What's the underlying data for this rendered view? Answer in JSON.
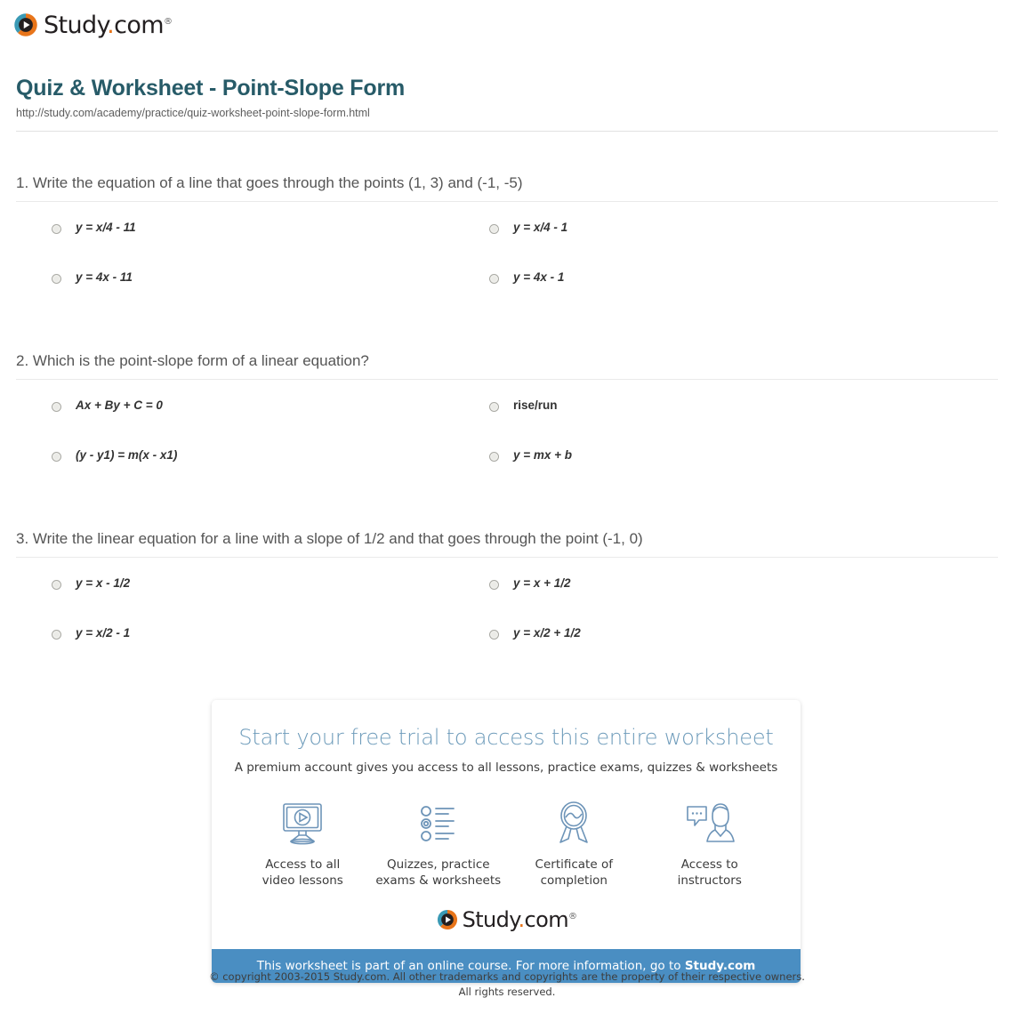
{
  "brand": {
    "name_main": "Study",
    "name_dot": ".",
    "name_tld": "com",
    "trademark": "®",
    "logo_icon": "play-circle-icon",
    "ring_teal": "#3a9ab5",
    "ring_orange": "#e8751a",
    "wordmark_color": "#231f20"
  },
  "header": {
    "title": "Quiz & Worksheet - Point-Slope Form",
    "title_color": "#275b68",
    "url": "http://study.com/academy/practice/quiz-worksheet-point-slope-form.html"
  },
  "questions": [
    {
      "text": "1. Write the equation of a line that goes through the points (1, 3) and (-1, -5)",
      "options": [
        {
          "label": "y = x/4 - 11",
          "style": "italic"
        },
        {
          "label": "y = x/4 - 1",
          "style": "italic"
        },
        {
          "label": "y = 4x - 11",
          "style": "italic"
        },
        {
          "label": "y = 4x - 1",
          "style": "italic"
        }
      ]
    },
    {
      "text": "2. Which is the point-slope form of a linear equation?",
      "options": [
        {
          "label": "Ax + By + C = 0",
          "style": "italic"
        },
        {
          "label": "rise/run",
          "style": "plain"
        },
        {
          "label": "(y - y1) = m(x - x1)",
          "style": "italic"
        },
        {
          "label": "y = mx + b",
          "style": "italic"
        }
      ]
    },
    {
      "text": "3. Write the linear equation for a line with a slope of 1/2 and that goes through the point (-1, 0)",
      "options": [
        {
          "label": "y = x - 1/2",
          "style": "italic"
        },
        {
          "label": "y = x + 1/2",
          "style": "italic"
        },
        {
          "label": "y = x/2 - 1",
          "style": "italic"
        },
        {
          "label": "y = x/2 + 1/2",
          "style": "italic"
        }
      ]
    }
  ],
  "promo": {
    "heading": "Start your free trial to access this entire worksheet",
    "heading_color": "#6d9bba",
    "subheading": "A premium account gives you access to all lessons, practice exams, quizzes & worksheets",
    "features": [
      {
        "icon": "monitor-play-icon",
        "line1": "Access to all",
        "line2": "video lessons"
      },
      {
        "icon": "quiz-list-icon",
        "line1": "Quizzes, practice",
        "line2": "exams & worksheets"
      },
      {
        "icon": "award-ribbon-icon",
        "line1": "Certificate of",
        "line2": "completion"
      },
      {
        "icon": "instructor-chat-icon",
        "line1": "Access to",
        "line2": "instructors"
      }
    ],
    "banner_text": "This worksheet is part of an online course. For more information, go to ",
    "banner_link": "Study.com",
    "banner_color": "#4a8ec2"
  },
  "footer": {
    "copyright_line1": "© copyright 2003-2015 Study.com. All other trademarks and copyrights are the property of their respective owners.",
    "copyright_line2": "All rights reserved."
  }
}
